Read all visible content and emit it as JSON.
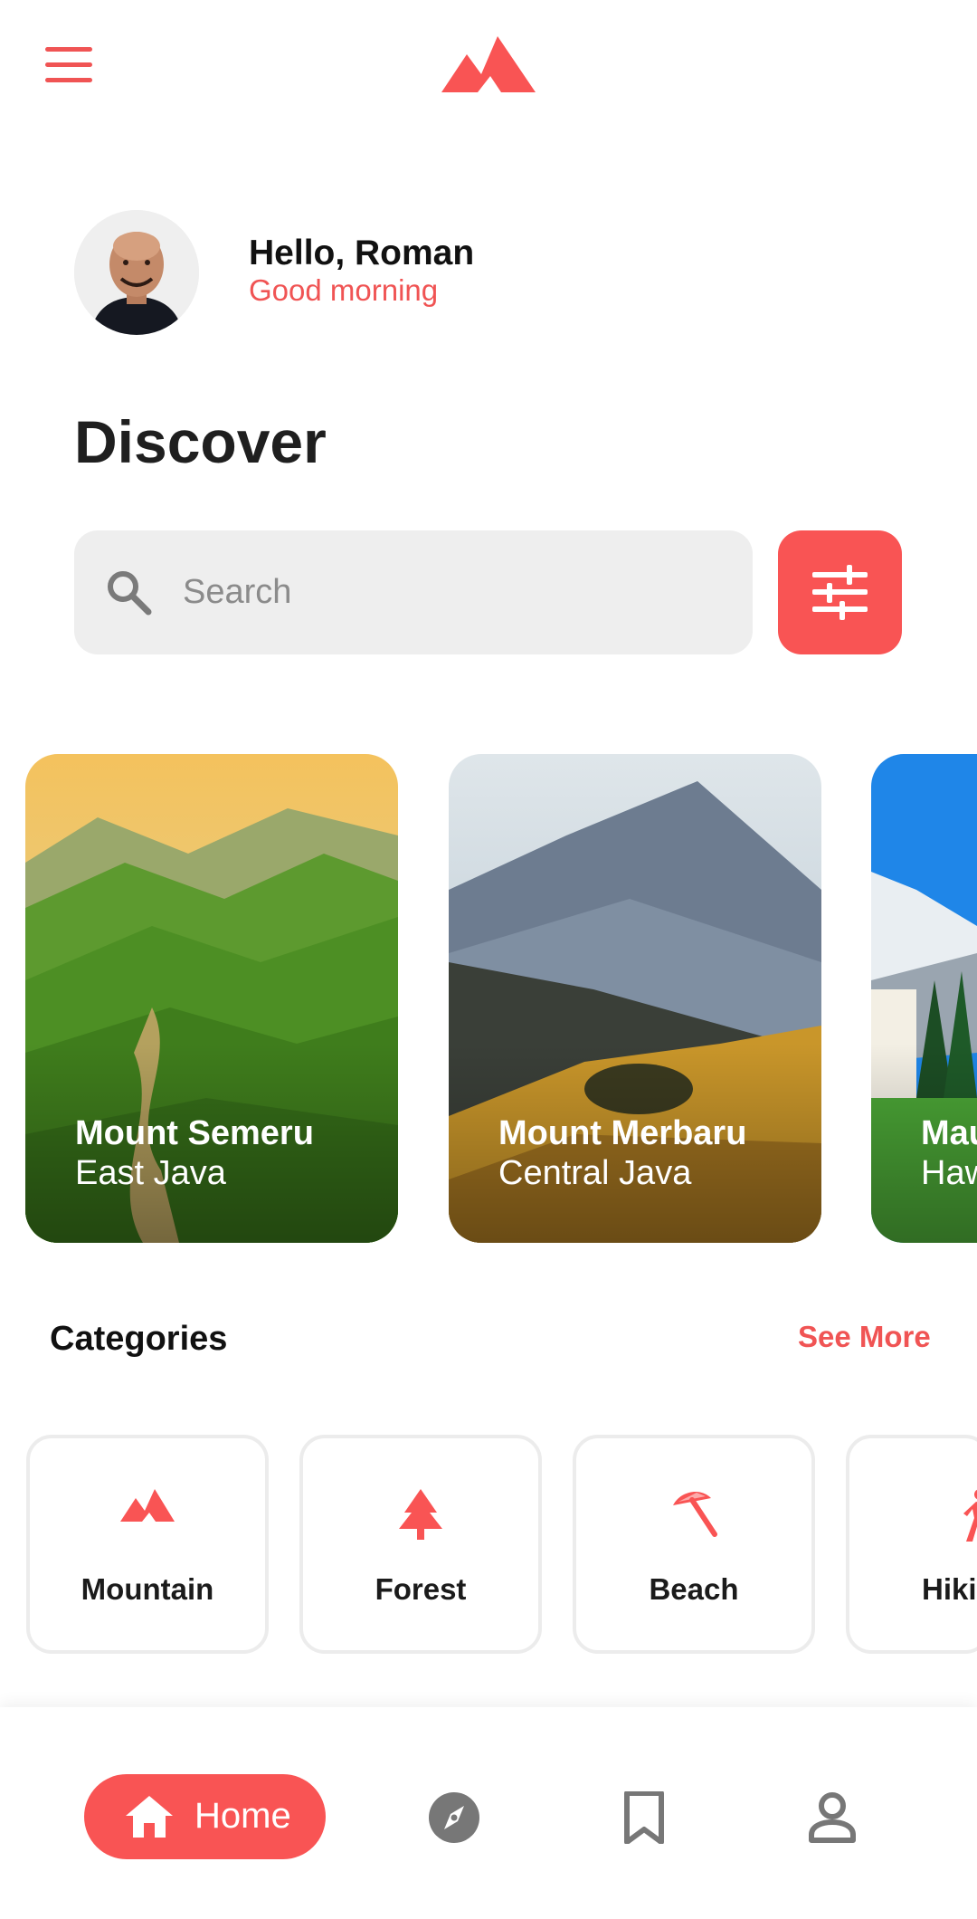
{
  "header": {
    "menu_icon": "menu-icon",
    "logo_icon": "mountain-logo-icon"
  },
  "greeting": {
    "hello": "Hello, Roman",
    "subtitle": "Good morning",
    "avatar": "avatar-photo"
  },
  "page": {
    "title": "Discover"
  },
  "search": {
    "placeholder": "Search",
    "value": "",
    "icon": "search-icon",
    "filter_icon": "sliders-icon"
  },
  "destinations": [
    {
      "title": "Mount Semeru",
      "subtitle": "East Java"
    },
    {
      "title": "Mount Merbaru",
      "subtitle": "Central Java"
    },
    {
      "title": "Mau",
      "subtitle": "Haw"
    }
  ],
  "categories": {
    "title": "Categories",
    "see_more": "See More",
    "items": [
      {
        "label": "Mountain",
        "icon": "mountain-icon"
      },
      {
        "label": "Forest",
        "icon": "tree-icon"
      },
      {
        "label": "Beach",
        "icon": "umbrella-icon"
      },
      {
        "label": "Hiki",
        "icon": "hiking-icon"
      }
    ]
  },
  "nav": {
    "home_label": "Home",
    "items": [
      "home-icon",
      "explore-compass-icon",
      "bookmark-icon",
      "profile-icon"
    ]
  },
  "colors": {
    "accent": "#f95454",
    "text": "#111111",
    "search_bg": "#eeeeee"
  }
}
